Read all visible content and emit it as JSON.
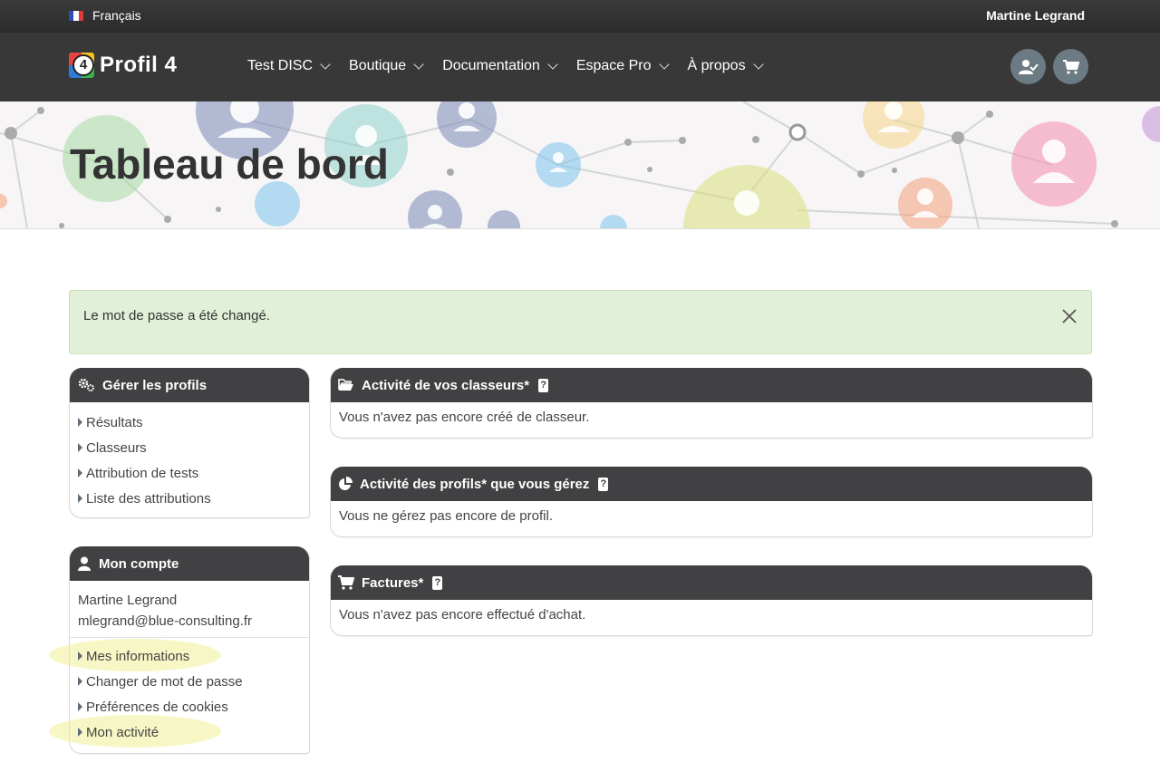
{
  "topbar": {
    "language": "Français",
    "user_name": "Martine Legrand"
  },
  "nav": {
    "logo_text": "Profil 4",
    "logo_number": "4",
    "items": [
      {
        "label": "Test DISC"
      },
      {
        "label": "Boutique"
      },
      {
        "label": "Documentation"
      },
      {
        "label": "Espace Pro"
      },
      {
        "label": "À propos"
      }
    ]
  },
  "banner": {
    "title": "Tableau de bord"
  },
  "alert": {
    "message": "Le mot de passe a été changé."
  },
  "manage_profiles": {
    "title": "Gérer les profils",
    "links": [
      "Résultats",
      "Classeurs",
      "Attribution de tests",
      "Liste des attributions"
    ]
  },
  "account": {
    "title": "Mon compte",
    "name": "Martine Legrand",
    "email": "mlegrand@blue-consulting.fr",
    "links": [
      "Mes informations",
      "Changer de mot de passe",
      "Préférences de cookies",
      "Mon activité"
    ]
  },
  "binders": {
    "title": "Activité de vos classeurs*",
    "empty": "Vous n'avez pas encore créé de classeur."
  },
  "profiles_activity": {
    "title": "Activité des profils* que vous gérez",
    "empty": "Vous ne gérez pas encore de profil."
  },
  "invoices": {
    "title": "Factures*",
    "empty": "Vous n'avez pas encore effectué d'achat."
  },
  "colors": {
    "header_dark": "#383838",
    "panel_head": "#414042",
    "alert_bg": "#e2f0d8",
    "accent_slate": "#6c7a84"
  }
}
